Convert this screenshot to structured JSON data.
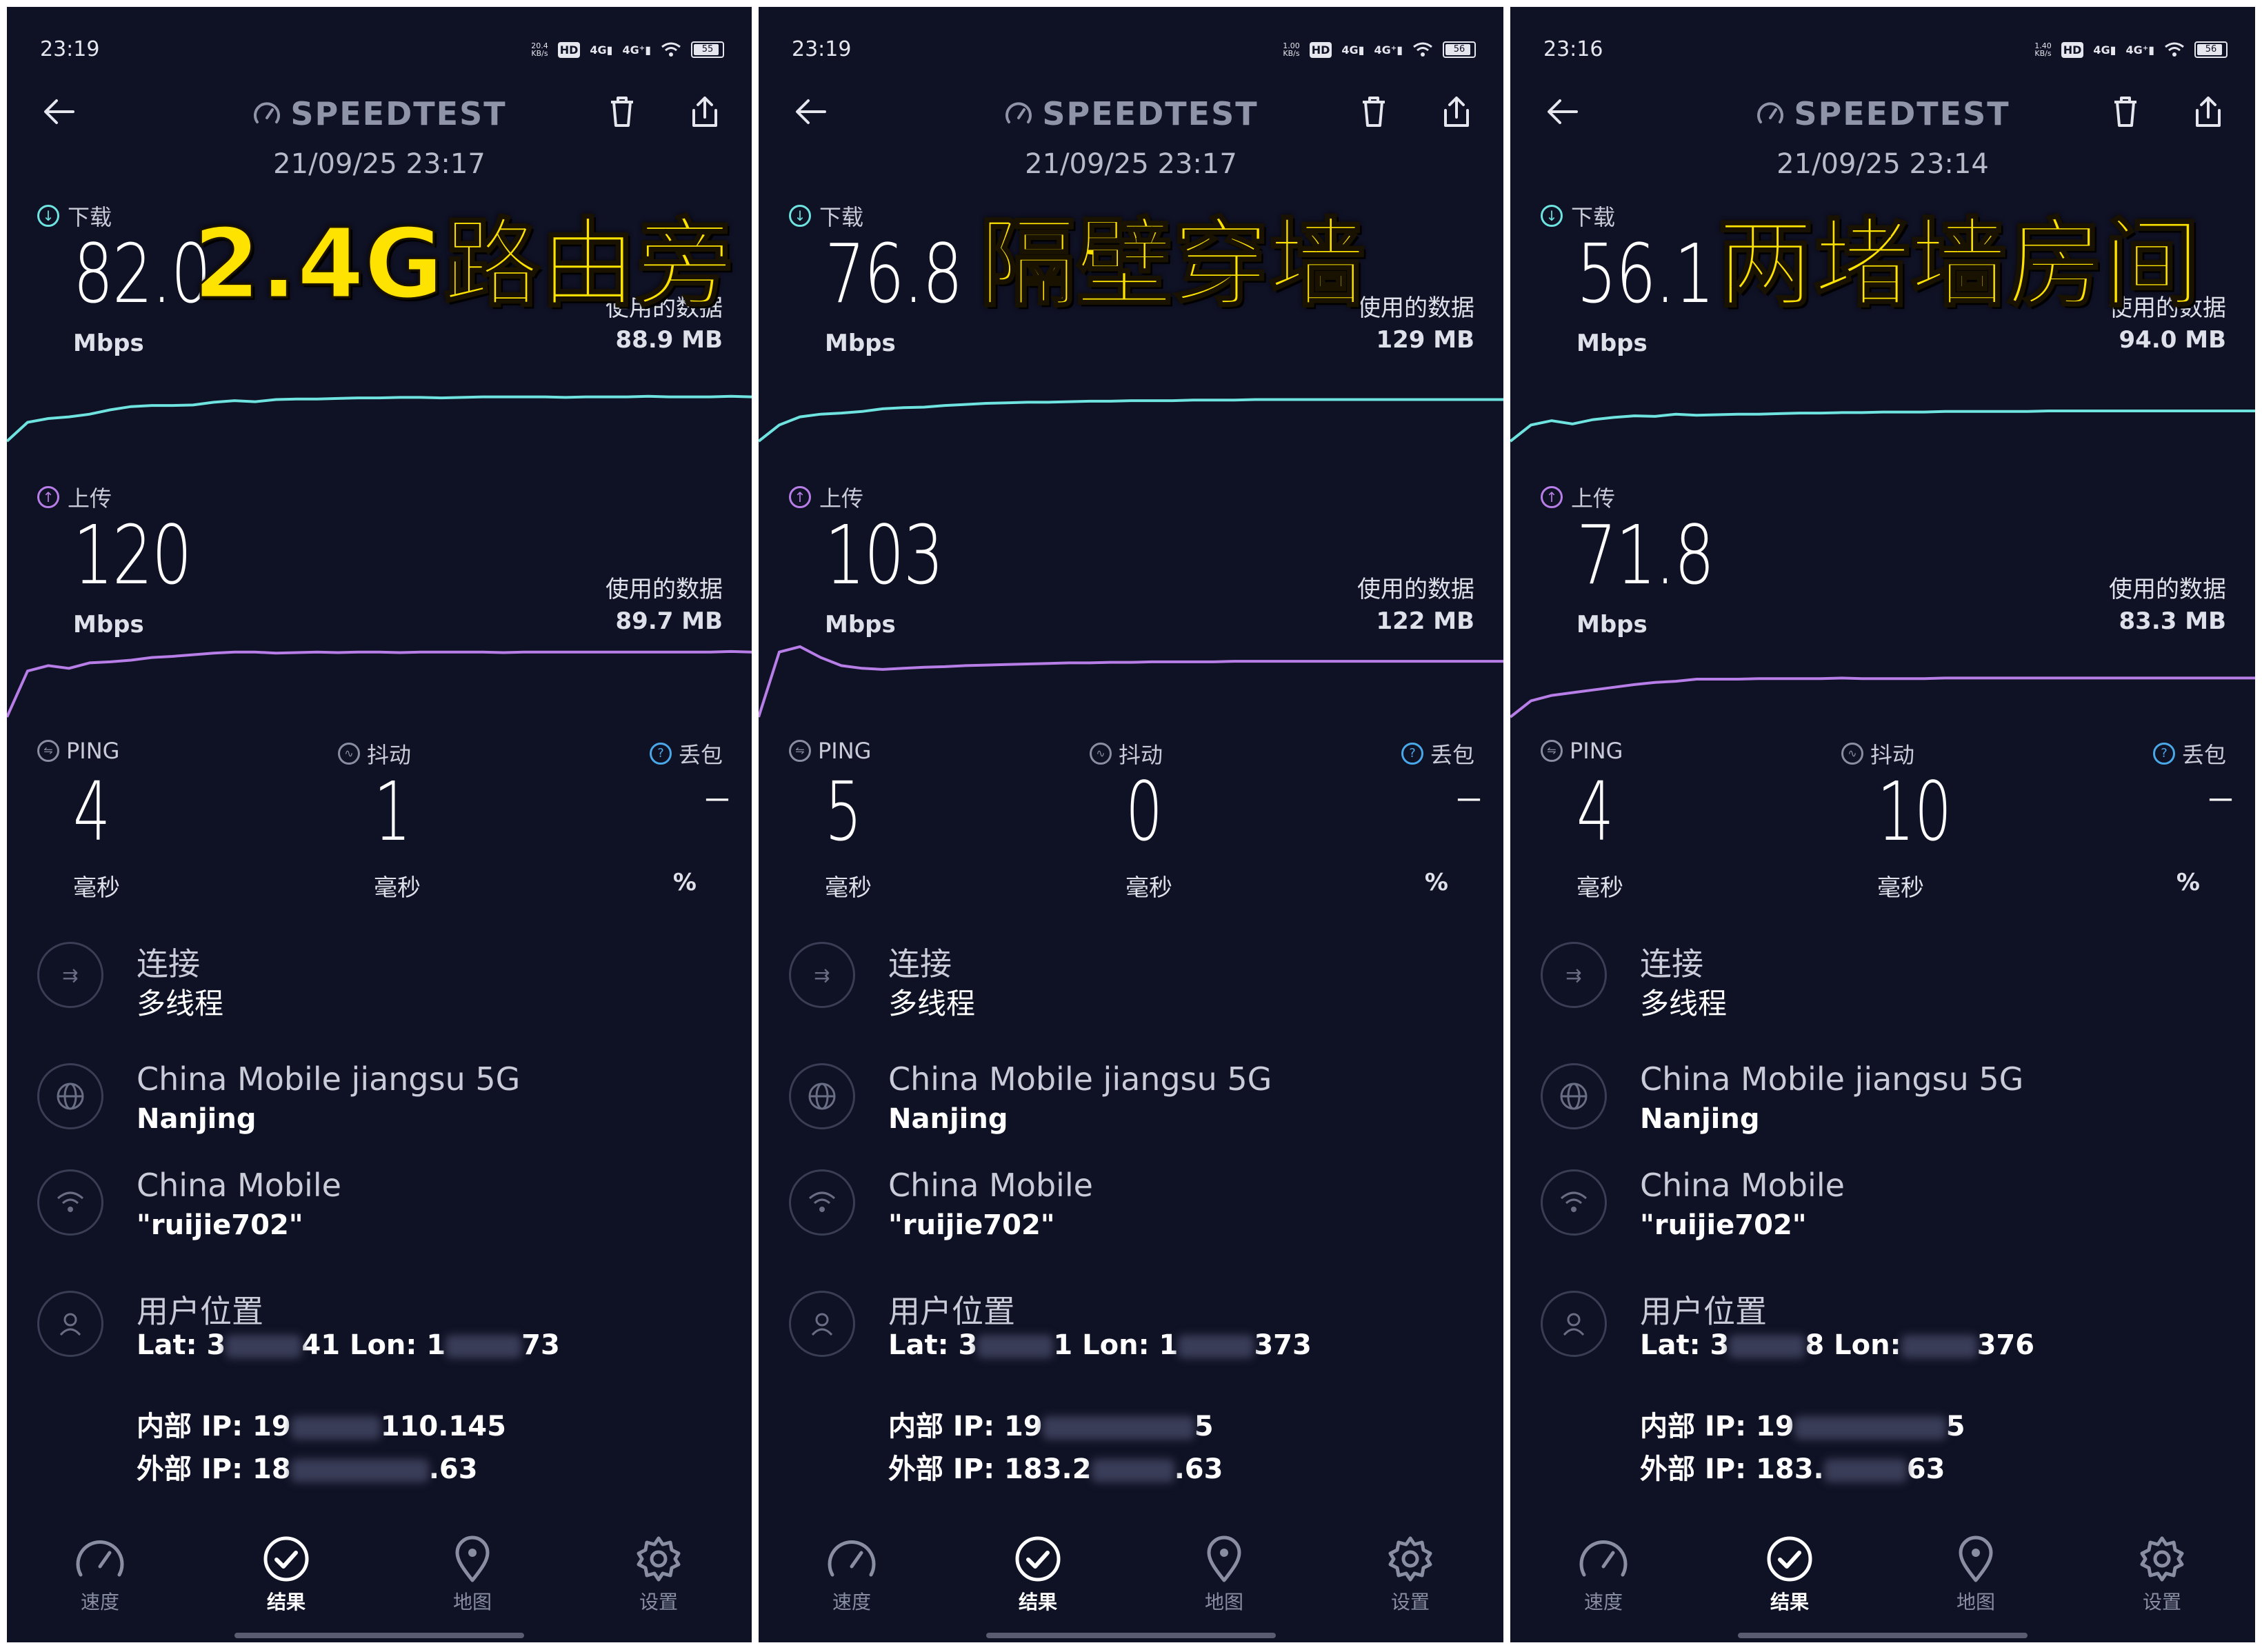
{
  "panels": [
    {
      "status_time": "23:19",
      "net_speed": "20.4",
      "net_unit": "KB/s",
      "battery": "55",
      "app_title": "SPEEDTEST",
      "datetime": "21/09/25 23:17",
      "overlay_label": "2.4G路由旁",
      "download": {
        "label": "下载",
        "value": "82.0",
        "unit": "Mbps",
        "used_label": "使用的数据",
        "used_value": "88.9 MB",
        "trace": [
          0.0,
          0.35,
          0.42,
          0.45,
          0.5,
          0.58,
          0.64,
          0.66,
          0.66,
          0.67,
          0.72,
          0.75,
          0.73,
          0.77,
          0.78,
          0.78,
          0.79,
          0.8,
          0.8,
          0.81,
          0.81,
          0.8,
          0.81,
          0.82,
          0.82,
          0.82,
          0.82,
          0.81,
          0.82,
          0.82,
          0.82,
          0.83,
          0.82,
          0.82,
          0.82,
          0.83,
          0.82
        ]
      },
      "upload": {
        "label": "上传",
        "value": "120",
        "unit": "Mbps",
        "used_label": "使用的数据",
        "used_value": "89.7 MB",
        "trace": [
          0.0,
          0.85,
          0.95,
          0.9,
          1.0,
          1.02,
          1.05,
          1.1,
          1.12,
          1.15,
          1.18,
          1.2,
          1.2,
          1.18,
          1.19,
          1.2,
          1.19,
          1.2,
          1.2,
          1.19,
          1.2,
          1.2,
          1.2,
          1.2,
          1.19,
          1.2,
          1.2,
          1.2,
          1.2,
          1.2,
          1.2,
          1.2,
          1.2,
          1.2,
          1.2,
          1.21,
          1.2
        ]
      },
      "ping": {
        "label": "PING",
        "value": "4",
        "unit": "毫秒"
      },
      "jitter": {
        "label": "抖动",
        "value": "1",
        "unit": "毫秒"
      },
      "loss": {
        "label": "丢包",
        "value": "–",
        "unit": "%"
      },
      "connection": {
        "title": "连接",
        "sub": "多线程"
      },
      "server": {
        "title": "China Mobile jiangsu 5G",
        "sub": "Nanjing"
      },
      "provider": {
        "title": "China Mobile",
        "sub": "\"ruijie702\""
      },
      "location": {
        "title": "用户位置",
        "lat_prefix": "Lat: 3",
        "lat_mid": "41 Lon: 1",
        "lon_suffix": "73"
      },
      "internal_ip": {
        "prefix": "内部 IP: 19",
        "suffix": "110.145"
      },
      "external_ip": {
        "prefix": "外部 IP: 18",
        "suffix": ".63"
      }
    },
    {
      "status_time": "23:19",
      "net_speed": "1.00",
      "net_unit": "KB/s",
      "battery": "56",
      "app_title": "SPEEDTEST",
      "datetime": "21/09/25 23:17",
      "overlay_label": "隔壁穿墙",
      "download": {
        "label": "下载",
        "value": "76.8",
        "unit": "Mbps",
        "used_label": "使用的数据",
        "used_value": "129 MB",
        "trace": [
          0.0,
          0.3,
          0.45,
          0.5,
          0.52,
          0.55,
          0.6,
          0.62,
          0.63,
          0.66,
          0.68,
          0.7,
          0.71,
          0.72,
          0.72,
          0.73,
          0.74,
          0.74,
          0.75,
          0.75,
          0.75,
          0.76,
          0.76,
          0.76,
          0.77,
          0.77,
          0.77,
          0.77,
          0.77,
          0.77,
          0.77,
          0.77,
          0.77,
          0.77,
          0.77,
          0.77,
          0.77
        ]
      },
      "upload": {
        "label": "上传",
        "value": "103",
        "unit": "Mbps",
        "used_label": "使用的数据",
        "used_value": "122 MB",
        "trace": [
          0.0,
          1.2,
          1.3,
          1.1,
          0.95,
          0.9,
          0.88,
          0.9,
          0.92,
          0.93,
          0.95,
          0.96,
          0.97,
          0.98,
          0.99,
          1.0,
          1.0,
          1.01,
          1.01,
          1.02,
          1.02,
          1.02,
          1.02,
          1.03,
          1.03,
          1.03,
          1.03,
          1.03,
          1.03,
          1.03,
          1.03,
          1.03,
          1.03,
          1.03,
          1.03,
          1.03,
          1.03
        ]
      },
      "ping": {
        "label": "PING",
        "value": "5",
        "unit": "毫秒"
      },
      "jitter": {
        "label": "抖动",
        "value": "0",
        "unit": "毫秒"
      },
      "loss": {
        "label": "丢包",
        "value": "–",
        "unit": "%"
      },
      "connection": {
        "title": "连接",
        "sub": "多线程"
      },
      "server": {
        "title": "China Mobile jiangsu 5G",
        "sub": "Nanjing"
      },
      "provider": {
        "title": "China Mobile",
        "sub": "\"ruijie702\""
      },
      "location": {
        "title": "用户位置",
        "lat_prefix": "Lat: 3",
        "lat_mid": "1 Lon: 1",
        "lon_suffix": "373"
      },
      "internal_ip": {
        "prefix": "内部 IP: 19",
        "suffix": "5"
      },
      "external_ip": {
        "prefix": "外部 IP: 183.2",
        "suffix": ".63"
      }
    },
    {
      "status_time": "23:16",
      "net_speed": "1.40",
      "net_unit": "KB/s",
      "battery": "56",
      "app_title": "SPEEDTEST",
      "datetime": "21/09/25 23:14",
      "overlay_label": "两堵墙房间",
      "download": {
        "label": "下载",
        "value": "56.1",
        "unit": "Mbps",
        "used_label": "使用的数据",
        "used_value": "94.0 MB",
        "trace": [
          0.0,
          0.3,
          0.38,
          0.32,
          0.4,
          0.44,
          0.47,
          0.46,
          0.5,
          0.48,
          0.49,
          0.5,
          0.5,
          0.51,
          0.52,
          0.52,
          0.53,
          0.53,
          0.54,
          0.54,
          0.54,
          0.55,
          0.55,
          0.55,
          0.55,
          0.55,
          0.56,
          0.56,
          0.56,
          0.56,
          0.56,
          0.56,
          0.56,
          0.56,
          0.56,
          0.56,
          0.56
        ]
      },
      "upload": {
        "label": "上传",
        "value": "71.8",
        "unit": "Mbps",
        "used_label": "使用的数据",
        "used_value": "83.3 MB",
        "trace": [
          0.0,
          0.3,
          0.4,
          0.45,
          0.5,
          0.55,
          0.6,
          0.64,
          0.66,
          0.7,
          0.7,
          0.7,
          0.71,
          0.71,
          0.71,
          0.71,
          0.72,
          0.71,
          0.71,
          0.71,
          0.71,
          0.72,
          0.72,
          0.72,
          0.72,
          0.72,
          0.72,
          0.72,
          0.72,
          0.72,
          0.72,
          0.72,
          0.72,
          0.72,
          0.72,
          0.72,
          0.72
        ]
      },
      "ping": {
        "label": "PING",
        "value": "4",
        "unit": "毫秒"
      },
      "jitter": {
        "label": "抖动",
        "value": "10",
        "unit": "毫秒"
      },
      "loss": {
        "label": "丢包",
        "value": "–",
        "unit": "%"
      },
      "connection": {
        "title": "连接",
        "sub": "多线程"
      },
      "server": {
        "title": "China Mobile jiangsu 5G",
        "sub": "Nanjing"
      },
      "provider": {
        "title": "China Mobile",
        "sub": "\"ruijie702\""
      },
      "location": {
        "title": "用户位置",
        "lat_prefix": "Lat: 3",
        "lat_mid": "8 Lon:",
        "lon_suffix": "376"
      },
      "internal_ip": {
        "prefix": "内部 IP: 19",
        "suffix": "5"
      },
      "external_ip": {
        "prefix": "外部 IP: 183.",
        "suffix": "63"
      }
    }
  ],
  "nav": [
    {
      "label": "速度",
      "icon": "speedometer-icon"
    },
    {
      "label": "结果",
      "icon": "check-circle-icon",
      "active": true
    },
    {
      "label": "地图",
      "icon": "map-pin-icon"
    },
    {
      "label": "设置",
      "icon": "gear-icon"
    }
  ],
  "colors": {
    "background": "#0f1124",
    "download": "#6fe3e0",
    "upload": "#b87ee8",
    "overlay_text": "#ffe300",
    "ping_icon": "#8a8ea3",
    "loss_icon": "#4aa8e8"
  }
}
